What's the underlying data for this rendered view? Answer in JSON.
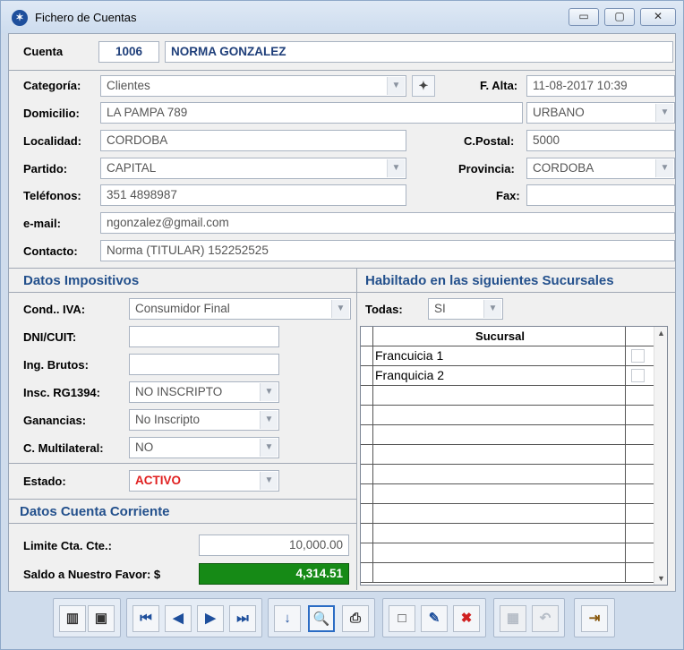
{
  "window": {
    "title": "Fichero de Cuentas",
    "min": "▭",
    "max": "▢",
    "close": "✕"
  },
  "cuenta": {
    "label": "Cuenta",
    "code": "1006",
    "name": "NORMA GONZALEZ"
  },
  "categoria": {
    "label": "Categoría:",
    "value": "Clientes"
  },
  "alta": {
    "label": "F. Alta:",
    "value": "11-08-2017 10:39"
  },
  "domicilio": {
    "label": "Domicilio:",
    "value": "LA PAMPA 789",
    "zona": "URBANO"
  },
  "localidad": {
    "label": "Localidad:",
    "value": "CORDOBA"
  },
  "cpostal": {
    "label": "C.Postal:",
    "value": "5000"
  },
  "partido": {
    "label": "Partido:",
    "value": "CAPITAL"
  },
  "provincia": {
    "label": "Provincia:",
    "value": "CORDOBA"
  },
  "telefonos": {
    "label": "Teléfonos:",
    "value": "351 4898987"
  },
  "fax": {
    "label": "Fax:",
    "value": ""
  },
  "email": {
    "label": "e-mail:",
    "value": "ngonzalez@gmail.com"
  },
  "contacto": {
    "label": "Contacto:",
    "value": "Norma (TITULAR) 152252525"
  },
  "impositivos": {
    "title": "Datos Impositivos",
    "cond_iva": {
      "label": "Cond.. IVA:",
      "value": "Consumidor Final"
    },
    "dni": {
      "label": "DNI/CUIT:",
      "value": ""
    },
    "ing_brutos": {
      "label": "Ing. Brutos:",
      "value": ""
    },
    "rg1394": {
      "label": "Insc. RG1394:",
      "value": "NO INSCRIPTO"
    },
    "ganancias": {
      "label": "Ganancias:",
      "value": "No Inscripto"
    },
    "multilateral": {
      "label": "C. Multilateral:",
      "value": "NO"
    }
  },
  "estado": {
    "label": "Estado:",
    "value": "ACTIVO",
    "color": "#e02020"
  },
  "cuenta_corriente": {
    "title": "Datos Cuenta Corriente",
    "limite_label": "Limite Cta. Cte.:",
    "limite_value": "10,000.00",
    "saldo_label": "Saldo a Nuestro Favor: $",
    "saldo_value": "4,314.51",
    "saldo_color": "#168a16"
  },
  "sucursales": {
    "title": "Habiltado en las siguientes Sucursales",
    "todas_label": "Todas:",
    "todas_value": "SI",
    "header": "Sucursal",
    "rows": [
      {
        "name": "Francuicia 1"
      },
      {
        "name": "Franquicia 2"
      }
    ]
  },
  "icons": {
    "wand": "✦",
    "scroll_up": "▲",
    "scroll_down": "▼",
    "arrow": "▼"
  },
  "toolbar": {
    "bank": "▥",
    "select": "▣",
    "first": "⏮",
    "prev": "◀",
    "next": "▶",
    "last": "⏭",
    "sort": "↓",
    "find": "🔍",
    "print": "⎙",
    "new": "□",
    "edit": "✎",
    "delete": "✖",
    "save": "▦",
    "undo": "↶",
    "exit": "⇥"
  }
}
